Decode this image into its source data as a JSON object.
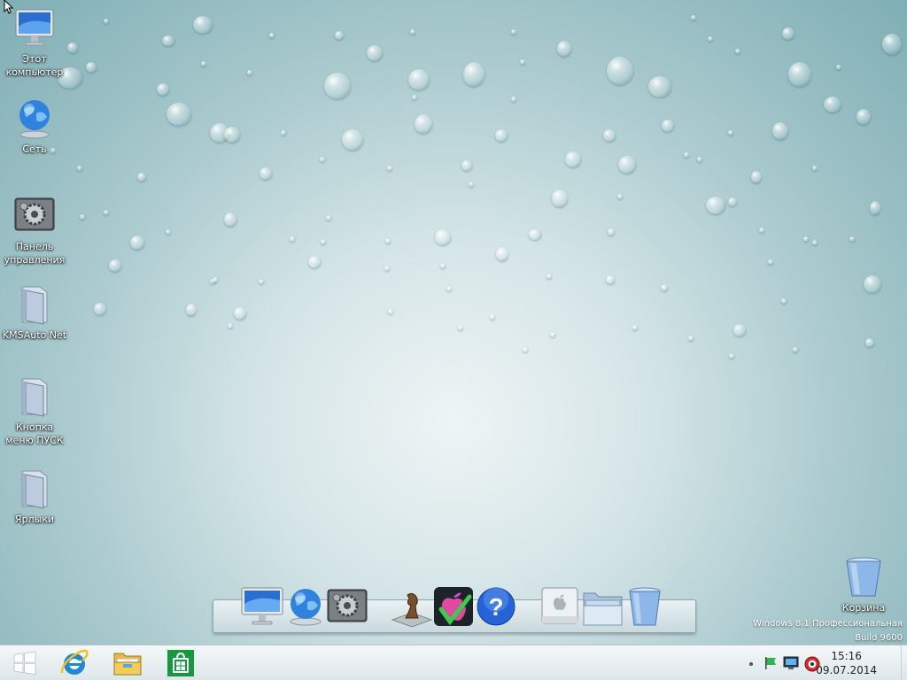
{
  "desktop_icons": [
    {
      "label": "Этот компьютер",
      "icon": "computer-icon"
    },
    {
      "label": "Сеть",
      "icon": "network-globe-icon"
    },
    {
      "label": "Панель управления",
      "icon": "control-panel-icon"
    },
    {
      "label": "KMSAuto Net",
      "icon": "folder-icon"
    },
    {
      "label": "Кнопка меню ПУСК",
      "icon": "folder-icon"
    },
    {
      "label": "Ярлыки",
      "icon": "folder-icon"
    }
  ],
  "recycle_bin": {
    "label": "Корзина",
    "icon": "recycle-bin-icon"
  },
  "dock_items": [
    "imac-icon",
    "network-globe-icon",
    "system-preferences-icon",
    "chess-icon",
    "apple-checkmark-icon",
    "help-icon",
    "drive-icon",
    "folder-stack-icon",
    "trash-icon"
  ],
  "watermark": {
    "edition": "Windows 8.1 Профессиональная",
    "build": "Build 9600"
  },
  "taskbar": {
    "pinned": [
      "windows-start-icon",
      "internet-explorer-icon",
      "file-explorer-icon",
      "store-icon"
    ],
    "tray": [
      "tray-dot-icon",
      "action-center-flag-icon",
      "network-monitor-icon",
      "volume-icon"
    ],
    "time": "15:16",
    "date": "09.07.2014"
  },
  "colors": {
    "wallpaper": "#a9c9cd",
    "taskbar": "#e8eef0",
    "store_green": "#139a3c",
    "ie_blue": "#1e88d6"
  }
}
